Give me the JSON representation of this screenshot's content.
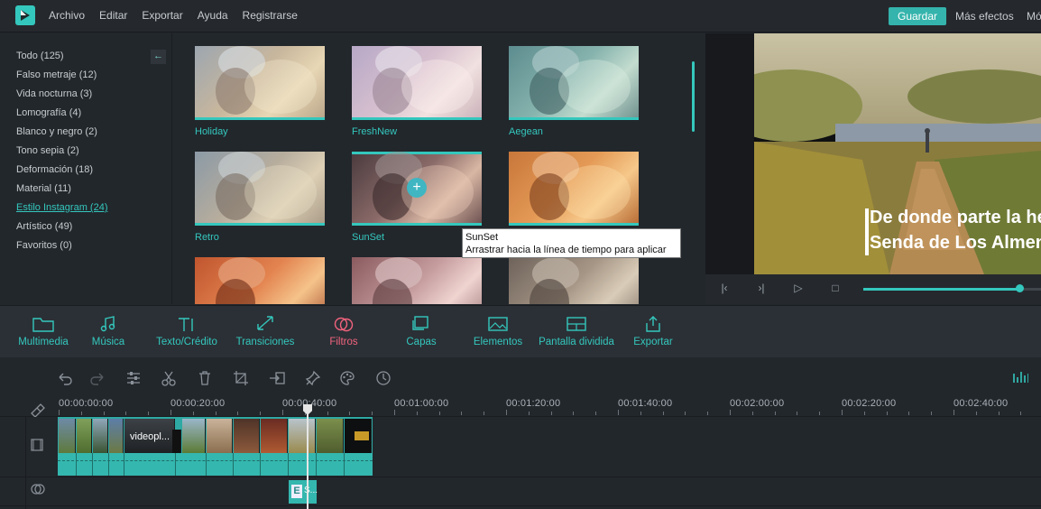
{
  "menu": {
    "items": [
      "Archivo",
      "Editar",
      "Exportar",
      "Ayuda",
      "Registrarse"
    ],
    "save_label": "Guardar",
    "more_effects_label": "Más efectos",
    "more_cut_label": "Mó"
  },
  "categories": [
    {
      "label": "Todo (125)",
      "active": false
    },
    {
      "label": "Falso metraje (12)",
      "active": false
    },
    {
      "label": "Vida nocturna (3)",
      "active": false
    },
    {
      "label": "Lomografía (4)",
      "active": false
    },
    {
      "label": "Blanco y negro (2)",
      "active": false
    },
    {
      "label": "Tono sepia (2)",
      "active": false
    },
    {
      "label": "Deformación (18)",
      "active": false
    },
    {
      "label": "Material (11)",
      "active": false
    },
    {
      "label": "Estilo Instagram (24)",
      "active": true
    },
    {
      "label": "Artístico (49)",
      "active": false
    },
    {
      "label": "Favoritos (0)",
      "active": false
    }
  ],
  "filters": [
    {
      "label": "Holiday"
    },
    {
      "label": "FreshNew"
    },
    {
      "label": "Aegean"
    },
    {
      "label": "Retro"
    },
    {
      "label": "SunSet"
    },
    {
      "label": ""
    },
    {
      "label": ""
    },
    {
      "label": ""
    },
    {
      "label": ""
    }
  ],
  "tooltip": {
    "title": "SunSet",
    "text": "Arrastrar hacia la línea de tiempo para aplicar"
  },
  "preview": {
    "caption_line1": "De donde parte la hermo",
    "caption_line2": "Senda de Los Almendro",
    "progress": 0.88
  },
  "tools": [
    {
      "label": "Multimedia",
      "icon": "folder-icon",
      "active": false
    },
    {
      "label": "Música",
      "icon": "music-icon",
      "active": false
    },
    {
      "label": "Texto/Crédito",
      "icon": "text-icon",
      "active": false
    },
    {
      "label": "Transiciones",
      "icon": "transition-icon",
      "active": false
    },
    {
      "label": "Filtros",
      "icon": "filter-icon",
      "active": true
    },
    {
      "label": "Capas",
      "icon": "layers-icon",
      "active": false
    },
    {
      "label": "Elementos",
      "icon": "image-icon",
      "active": false
    },
    {
      "label": "Pantalla dividida",
      "icon": "split-screen-icon",
      "active": false
    },
    {
      "label": "Exportar",
      "icon": "export-icon",
      "active": false
    }
  ],
  "timeline": {
    "timecodes": [
      "00:00:00:00",
      "00:00:20:00",
      "00:00:40:00",
      "00:01:00:00",
      "00:01:20:00",
      "00:01:40:00",
      "00:02:00:00",
      "00:02:20:00",
      "00:02:40:00"
    ],
    "video_clip_label": "videopl...",
    "effect_clip_label": "S..."
  },
  "colors": {
    "accent": "#34c7bd",
    "active_tab": "#f2637e",
    "background": "#22272c"
  }
}
